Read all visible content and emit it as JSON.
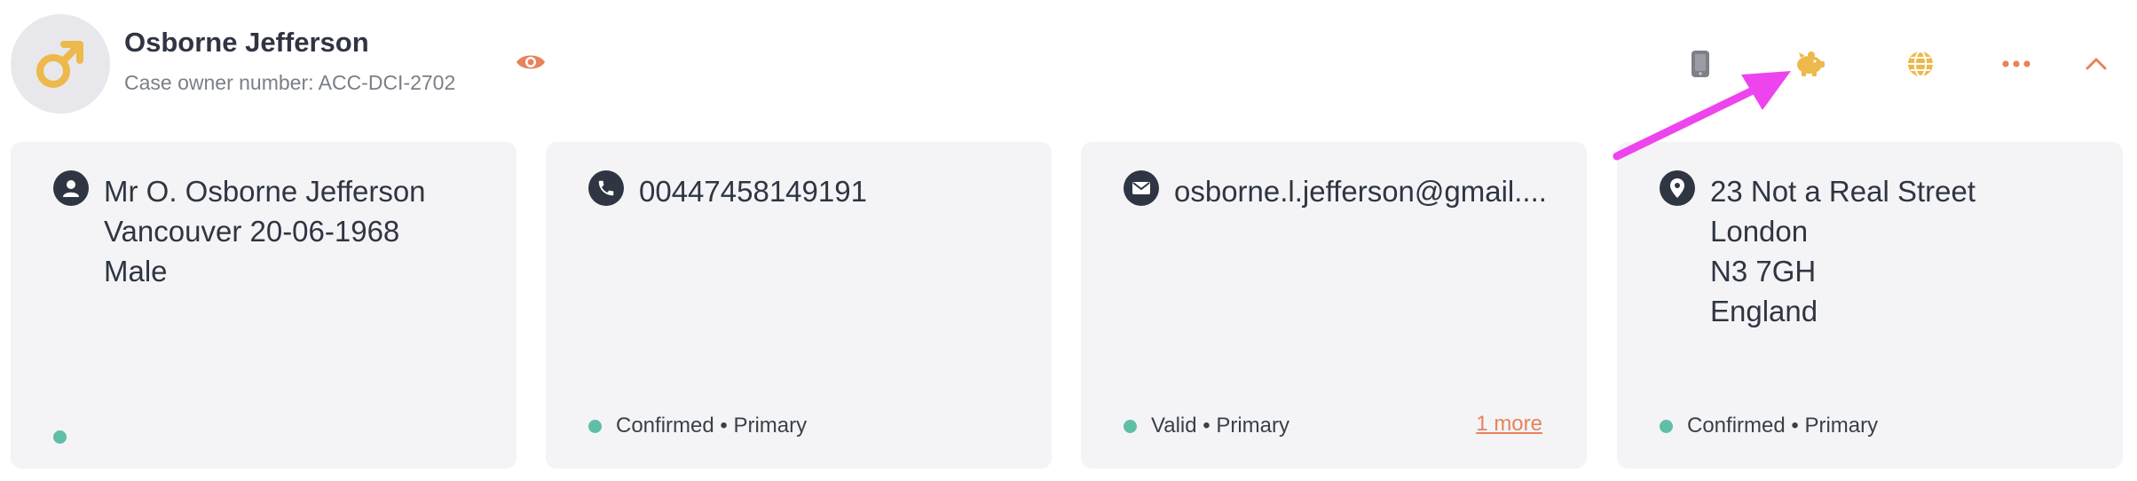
{
  "header": {
    "name": "Osborne Jefferson",
    "case_owner": "Case owner number: ACC-DCI-2702"
  },
  "icons": {
    "avatar": "male-symbol-icon",
    "view": "eye-icon",
    "actions": [
      "mobile-phone-icon",
      "piggy-bank-icon",
      "globe-icon",
      "more-options-icon",
      "chevron-up-icon"
    ]
  },
  "colors": {
    "accent": "#e8825a",
    "gold": "#ecb94a",
    "status_dot": "#5fbfa6",
    "card_bg": "#f4f4f6",
    "annotation_arrow": "#ee44ee"
  },
  "cards": {
    "person": {
      "lines": [
        "Mr O. Osborne Jefferson",
        "Vancouver 20-06-1968",
        "Male"
      ]
    },
    "phone": {
      "number": "00447458149191",
      "status": "Confirmed • Primary"
    },
    "email": {
      "address": "osborne.l.jefferson@gmail....",
      "status": "Valid • Primary",
      "more": "1 more"
    },
    "address": {
      "lines": [
        "23 Not a Real Street",
        "London",
        "N3 7GH",
        "England"
      ],
      "status": "Confirmed • Primary"
    }
  }
}
